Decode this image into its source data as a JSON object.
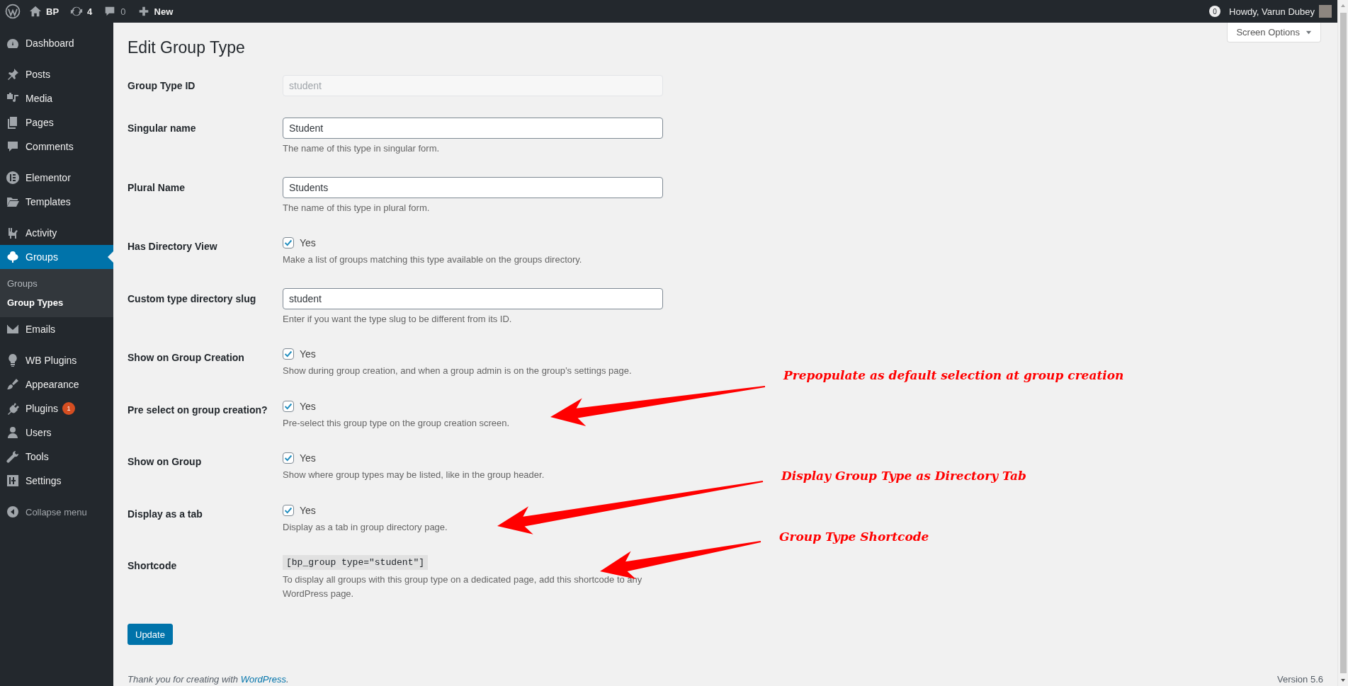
{
  "admin_bar": {
    "site": "BP",
    "updates": "4",
    "comments": "0",
    "new": "New",
    "notifications": "0",
    "greeting": "Howdy, Varun Dubey"
  },
  "sidebar": {
    "sections": [
      [
        {
          "label": "Dashboard",
          "selected": false
        }
      ],
      [
        {
          "label": "Posts",
          "selected": false
        },
        {
          "label": "Media",
          "selected": false
        },
        {
          "label": "Pages",
          "selected": false
        },
        {
          "label": "Comments",
          "selected": false
        }
      ],
      [
        {
          "label": "Elementor",
          "selected": false
        },
        {
          "label": "Templates",
          "selected": false
        }
      ],
      [
        {
          "label": "Activity",
          "selected": false
        },
        {
          "label": "Groups",
          "selected": true,
          "children": [
            {
              "label": "Groups",
              "selected": false
            },
            {
              "label": "Group Types",
              "selected": true
            }
          ]
        },
        {
          "label": "Emails",
          "selected": false
        }
      ],
      [
        {
          "label": "WB Plugins",
          "selected": false
        },
        {
          "label": "Appearance",
          "selected": false
        },
        {
          "label": "Plugins",
          "selected": false,
          "badge": "1"
        },
        {
          "label": "Users",
          "selected": false
        },
        {
          "label": "Tools",
          "selected": false
        },
        {
          "label": "Settings",
          "selected": false
        }
      ]
    ],
    "collapse": "Collapse menu"
  },
  "screen_options": "Screen Options",
  "title": "Edit Group Type",
  "fields": [
    {
      "kind": "readonly",
      "label": "Group Type ID",
      "value": "student"
    },
    {
      "kind": "text",
      "label": "Singular name",
      "value": "Student",
      "description": "The name of this type in singular form."
    },
    {
      "kind": "text",
      "label": "Plural Name",
      "value": "Students",
      "description": "The name of this type in plural form."
    },
    {
      "kind": "checkbox",
      "label": "Has Directory View",
      "option": "Yes",
      "checked": true,
      "description": "Make a list of groups matching this type available on the groups directory."
    },
    {
      "kind": "text",
      "label": "Custom type directory slug",
      "value": "student",
      "description": "Enter if you want the type slug to be different from its ID."
    },
    {
      "kind": "checkbox",
      "label": "Show on Group Creation",
      "option": "Yes",
      "checked": true,
      "description": "Show during group creation, and when a group admin is on the group’s settings page."
    },
    {
      "kind": "checkbox",
      "label": "Pre select on group creation?",
      "option": "Yes",
      "checked": true,
      "description": "Pre-select this group type on the group creation screen."
    },
    {
      "kind": "checkbox",
      "label": "Show on Group",
      "option": "Yes",
      "checked": true,
      "description": "Show where group types may be listed, like in the group header."
    },
    {
      "kind": "checkbox",
      "label": "Display as a tab",
      "option": "Yes",
      "checked": true,
      "description": "Display as a tab in group directory page."
    },
    {
      "kind": "code",
      "label": "Shortcode",
      "value": "[bp_group type=\"student\"]",
      "description": "To display all groups with this group type on a dedicated page, add this shortcode to any WordPress page."
    }
  ],
  "submit": "Update",
  "annotations": [
    {
      "text": "Prepopulate as default selection at group creation"
    },
    {
      "text": "Display Group Type as Directory Tab"
    },
    {
      "text": "Group Type Shortcode"
    }
  ],
  "footer": {
    "text": "Thank you for creating with ",
    "link": "WordPress",
    "after": ".",
    "version": "Version 5.6"
  }
}
